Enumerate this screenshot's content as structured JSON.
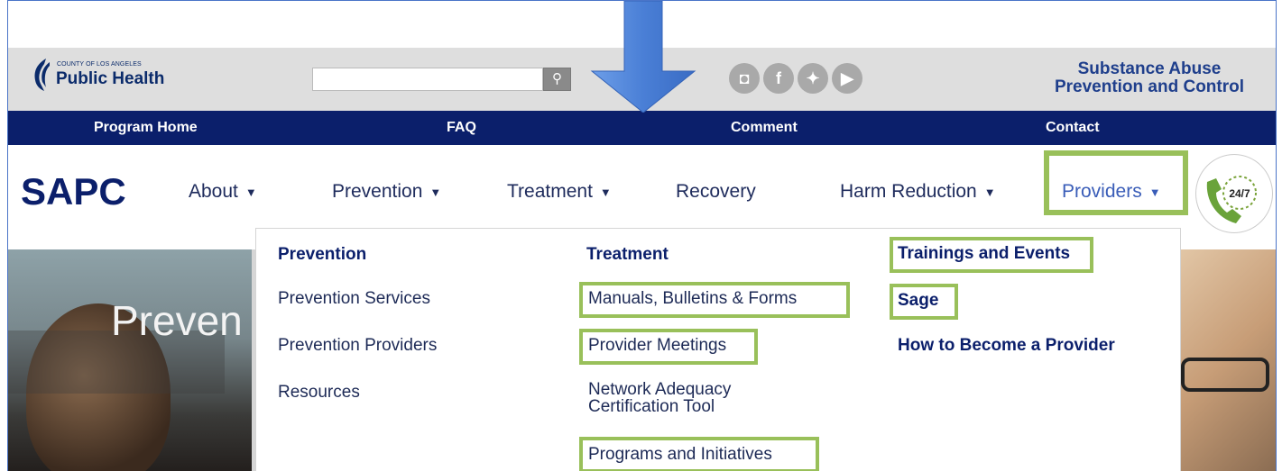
{
  "logo": {
    "small_text": "COUNTY OF LOS ANGELES",
    "big_text": "Public Health"
  },
  "search": {
    "placeholder": "",
    "button_icon": "search-icon"
  },
  "social": [
    {
      "icon": "instagram-icon",
      "glyph": "◘"
    },
    {
      "icon": "facebook-icon",
      "glyph": "f"
    },
    {
      "icon": "twitter-icon",
      "glyph": "✦"
    },
    {
      "icon": "youtube-icon",
      "glyph": "▶"
    }
  ],
  "program_title": {
    "line1": "Substance Abuse",
    "line2": "Prevention and Control"
  },
  "top_nav": [
    "Program Home",
    "FAQ",
    "Comment",
    "Contact"
  ],
  "brand": "SAPC",
  "main_menu": [
    "About",
    "Prevention",
    "Treatment",
    "Recovery",
    "Harm Reduction",
    "Providers"
  ],
  "phone_badge": "24/7",
  "hero_title": "Preven",
  "dropdown": {
    "col1": {
      "heading": "Prevention",
      "items": [
        "Prevention Services",
        "Prevention Providers",
        "Resources"
      ]
    },
    "col2": {
      "heading": "Treatment",
      "items": [
        "Manuals, Bulletins & Forms",
        "Provider Meetings",
        "Network Adequacy",
        "Certification Tool",
        "Programs and Initiatives"
      ]
    },
    "col3": {
      "items": [
        "Trainings and Events",
        "Sage",
        "How to Become a Provider"
      ]
    }
  },
  "colors": {
    "navy": "#0b1f6b",
    "highlight": "#99c05a",
    "link_blue": "#3a5db8",
    "arrow": "#5b8fe0"
  }
}
